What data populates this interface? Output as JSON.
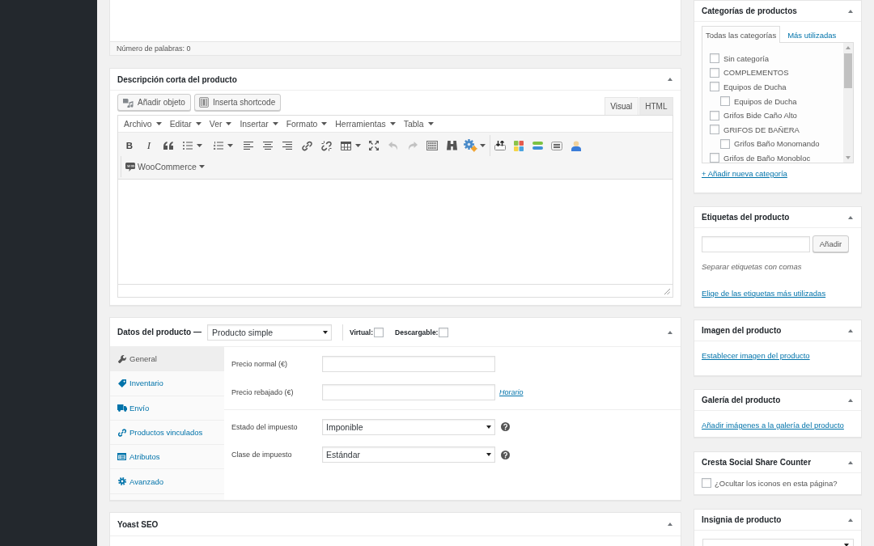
{
  "editor_tail": {
    "word_count": "Número de palabras: 0"
  },
  "short_description": {
    "title": "Descripción corta del producto",
    "media_buttons": [
      "Añadir objeto",
      "Inserta shortcode"
    ],
    "editor_tabs": [
      {
        "label": "Visual",
        "selected": true
      },
      {
        "label": "HTML",
        "selected": false
      }
    ],
    "menus": [
      "Archivo",
      "Editar",
      "Ver",
      "Insertar",
      "Formato",
      "Herramientas",
      "Tabla"
    ],
    "toolbar": {
      "bold": "B",
      "italic": "I",
      "undo_disabled": true,
      "redo_disabled": true
    },
    "toolbar_menus": [
      "WooCommerce"
    ]
  },
  "product_data": {
    "title": "Datos del producto —",
    "product_type": "Producto simple",
    "options": [
      {
        "label": "Virtual:",
        "checked": false
      },
      {
        "label": "Descargable:",
        "checked": false
      }
    ],
    "tabs": [
      {
        "label": "General",
        "selected": true
      },
      {
        "label": "Inventario",
        "selected": false
      },
      {
        "label": "Envío",
        "selected": false
      },
      {
        "label": "Productos vinculados",
        "selected": false
      },
      {
        "label": "Atributos",
        "selected": false
      },
      {
        "label": "Avanzado",
        "selected": false
      }
    ],
    "sections": [
      {
        "fields": [
          {
            "kind": "text",
            "label": "Precio normal (€)"
          },
          {
            "kind": "text",
            "label": "Precio rebajado (€)",
            "link": "Horario"
          }
        ]
      },
      {
        "fields": [
          {
            "kind": "select",
            "label": "Estado del impuesto",
            "value": "Imponible",
            "help": true
          },
          {
            "kind": "select",
            "label": "Clase de impuesto",
            "value": "Estándar",
            "help": true
          }
        ]
      }
    ]
  },
  "yoast_seo": {
    "title": "Yoast SEO"
  },
  "categories": {
    "title": "Categorías de productos",
    "tabs": [
      {
        "label": "Todas las categorías",
        "selected": true
      },
      {
        "label": "Más utilizadas",
        "selected": false
      }
    ],
    "items": [
      {
        "label": "Sin categoría",
        "checked": false
      },
      {
        "label": "COMPLEMENTOS",
        "checked": false
      },
      {
        "label": "Equipos de Ducha",
        "checked": false,
        "children": [
          {
            "label": "Equipos de Ducha",
            "checked": false
          }
        ]
      },
      {
        "label": "Grifos Bide Caño Alto",
        "checked": false
      },
      {
        "label": "GRIFOS DE BAÑERA",
        "checked": false,
        "children": [
          {
            "label": "Grifos Baño Monomando",
            "checked": false
          }
        ]
      },
      {
        "label": "Grifos de Baño Monobloc",
        "checked": false
      }
    ],
    "add_link": "+ Añadir nueva categoría"
  },
  "tags": {
    "title": "Etiquetas del producto",
    "button": "Añadir",
    "hint": "Separar etiquetas con comas",
    "link": "Elige de las etiquetas más utilizadas"
  },
  "product_image": {
    "title": "Imagen del producto",
    "link": "Establecer imagen del producto"
  },
  "gallery": {
    "title": "Galería del producto",
    "link": "Añadir imágenes a la galería del producto"
  },
  "social_share": {
    "title": "Cresta Social Share Counter",
    "checkbox": {
      "label": "¿Ocultar los iconos en esta página?",
      "checked": false
    }
  },
  "badge": {
    "title": "Insignia de producto"
  }
}
